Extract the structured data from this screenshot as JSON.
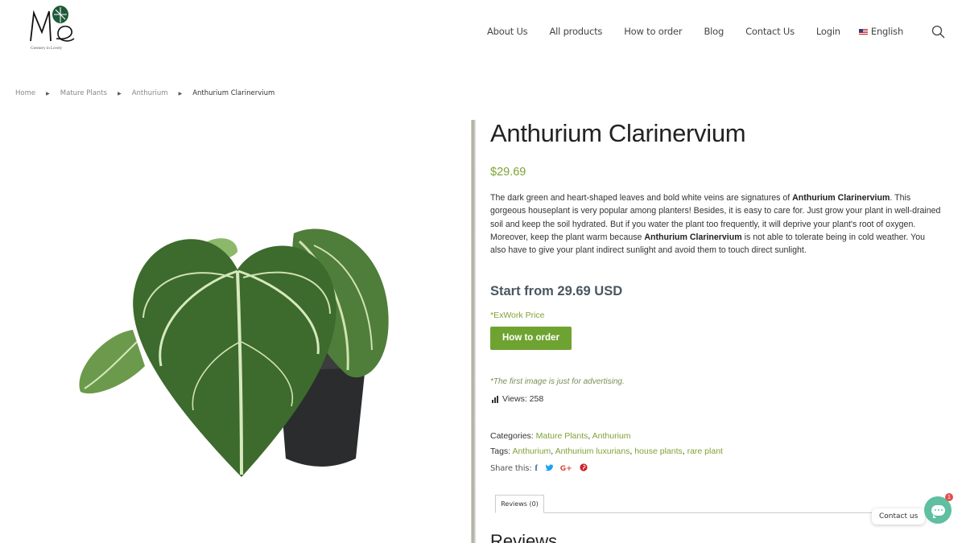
{
  "header": {
    "logo_text": "Me",
    "logo_sub": "Greenery in Lovely",
    "nav": [
      "About Us",
      "All products",
      "How to order",
      "Blog",
      "Contact Us",
      "Login"
    ],
    "language": "English"
  },
  "breadcrumb": {
    "items": [
      "Home",
      "Mature Plants",
      "Anthurium"
    ],
    "current": "Anthurium Clarinervium"
  },
  "product": {
    "title": "Anthurium Clarinervium",
    "price": "$29.69",
    "desc_1": "The dark green and heart-shaped leaves and bold white veins are signatures of ",
    "desc_bold_1": "Anthurium Clarinervium",
    "desc_2": ". This gorgeous houseplant is very popular among planters! Besides, it is easy to care for. Just grow your plant in well-drained soil and keep the soil hydrated. But if you water the plant too frequently, it will deprive your plant's root of oxygen. Moreover, keep the plant warm because ",
    "desc_bold_2": "Anthurium Clarinervium",
    "desc_3": " is not able to tolerate being in cold weather. You also have to give your plant indirect sunlight and avoid them to touch direct sunlight.",
    "start_from": "Start from 29.69 USD",
    "exwork": "*ExWork Price",
    "order_button": "How to order",
    "note": "*The first image is just for advertising.",
    "views_label": "Views: 258",
    "categories_label": "Categories: ",
    "categories": [
      "Mature Plants",
      "Anthurium"
    ],
    "tags_label": "Tags: ",
    "tags": [
      "Anthurium",
      "Anthurium luxurians",
      "house plants",
      "rare plant"
    ],
    "share_label": "Share this:",
    "share_icons": [
      "facebook-icon",
      "twitter-icon",
      "google-plus-icon",
      "pinterest-icon"
    ]
  },
  "tabs": {
    "reviews_tab": "Reviews (0)",
    "reviews_heading": "Reviews"
  },
  "contact_widget": {
    "label": "Contact us",
    "badge": "1"
  },
  "colors": {
    "accent_green": "#7fa236",
    "button_green": "#6fa331",
    "chat_teal": "#5fbfa0"
  }
}
